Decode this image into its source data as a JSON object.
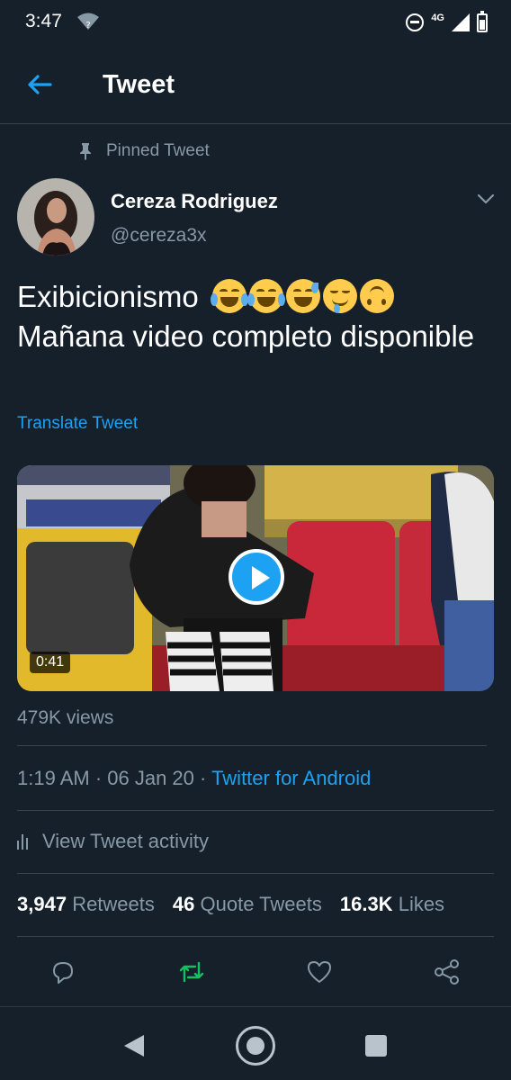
{
  "status_bar": {
    "time": "3:47",
    "wifi_badge": "?",
    "network": "4G",
    "icons": [
      "wifi-icon",
      "dnd-icon",
      "signal-icon",
      "battery-icon"
    ]
  },
  "header": {
    "title": "Tweet",
    "back_icon": "arrow-left-icon"
  },
  "tweet": {
    "pinned_label": "Pinned Tweet",
    "author": {
      "name": "Cereza Rodriguez",
      "handle": "@cereza3x"
    },
    "text_line1": "Exibicionismo",
    "emojis": [
      "joy-emoji",
      "joy-emoji",
      "sweat-smile-emoji",
      "drooling-emoji",
      "upside-down-emoji"
    ],
    "text_rest": "Mañana video completo disponible",
    "translate_label": "Translate Tweet",
    "media": {
      "type": "video",
      "duration": "0:41"
    },
    "views": "479K views",
    "timestamp": "1:19 AM · 06 Jan 20 · ",
    "source": "Twitter for Android",
    "activity_label": "View Tweet activity",
    "stats": {
      "retweets_count": "3,947",
      "retweets_label": "Retweets",
      "quotes_count": "46",
      "quotes_label": "Quote Tweets",
      "likes_count": "16.3K",
      "likes_label": "Likes"
    }
  },
  "colors": {
    "background": "#15202b",
    "accent": "#1da1f2",
    "secondary_text": "#8899a6",
    "retweeted": "#17bf63",
    "divider": "#38444d"
  },
  "actions": [
    "reply-icon",
    "retweet-icon",
    "like-icon",
    "share-icon"
  ],
  "nav": [
    "nav-back-icon",
    "nav-home-icon",
    "nav-recents-icon"
  ]
}
